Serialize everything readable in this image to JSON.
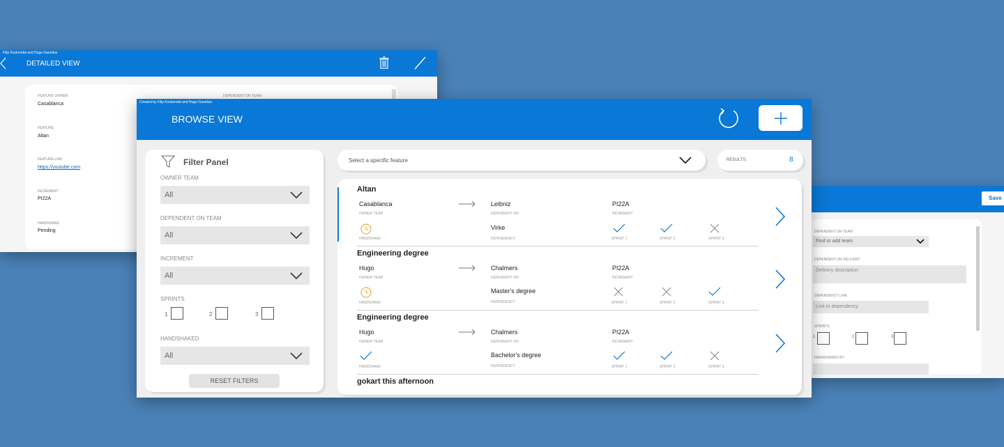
{
  "detailed": {
    "credit": "Filip Kockendal and Hugo Ganelius",
    "title": "DETAILED VIEW",
    "fields": [
      {
        "label": "FEATURE OWNER",
        "value": "Casablanca"
      },
      {
        "label": "FEATURE",
        "value": "Altan"
      },
      {
        "label": "FEATURE LINK",
        "value": "https://youtube.com"
      },
      {
        "label": "INCREMENT",
        "value": "PI22A"
      },
      {
        "label": "HANDSHAKE",
        "value": "Pending"
      }
    ],
    "dependent_on_team_label": "DEPENDENT ON TEAM"
  },
  "browse": {
    "credit": "Created by Filip Kockendal and Hugo Ganelius",
    "title": "BROWSE VIEW",
    "filter": {
      "title": "Filter Panel",
      "owner_team_label": "OWNER TEAM",
      "owner_team_value": "All",
      "dependent_label": "DEPENDENT ON TEAM",
      "dependent_value": "All",
      "increment_label": "INCREMENT",
      "increment_value": "All",
      "sprints_label": "SPRINTS",
      "sprint_numbers": [
        "1",
        "2",
        "3"
      ],
      "handshaked_label": "HANDSHAKED",
      "handshaked_value": "All",
      "reset_label": "RESET FILTERS"
    },
    "feature_select_placeholder": "Select a specific feature",
    "results_label": "RESULTS:",
    "results_count": "8",
    "labels": {
      "owner_team": "OWNER TEAM",
      "dependent_on": "DEPENDENT ON",
      "increment": "INCREMENT",
      "handshake": "HANDSHAKE",
      "dependency": "DEPENDENCY",
      "sprint1": "SPRINT 1",
      "sprint2": "SPRINT 2",
      "sprint3": "SPRINT 3"
    },
    "rows": [
      {
        "title": "Altan",
        "owner": "Casablanca",
        "dependent_on": "Leibniz",
        "increment": "PI22A",
        "dependency": "Virke",
        "handshake": "pending",
        "sprints": [
          true,
          true,
          false
        ]
      },
      {
        "title": "Engineering degree",
        "owner": "Hugo",
        "dependent_on": "Chalmers",
        "increment": "PI22A",
        "dependency": "Master's degree",
        "handshake": "pending",
        "sprints": [
          false,
          false,
          true
        ]
      },
      {
        "title": "Engineering degree",
        "owner": "Hugo",
        "dependent_on": "Chalmers",
        "increment": "PI22A",
        "dependency": "Bachelor's degree",
        "handshake": "done",
        "sprints": [
          true,
          true,
          false
        ]
      },
      {
        "title": "gokart this afternoon"
      }
    ]
  },
  "edit": {
    "save_label": "Save",
    "dependent_on_team_label": "DEPENDENT ON TEAM",
    "team_placeholder": "Find or add team",
    "delivery_label": "DEPENDENT ON DELIVERY",
    "delivery_placeholder": "Delivery description",
    "link_label": "DEPENDENCY LINK",
    "link_placeholder": "Link to dependency",
    "sprints_label": "SPRINTS",
    "sprint_numbers": [
      "1",
      "2",
      "3"
    ],
    "handshaked_by_label": "HANDSHAKED BY"
  },
  "colors": {
    "accent": "#0a78d6",
    "background": "#4a82b8",
    "pending": "#e8b04a"
  }
}
